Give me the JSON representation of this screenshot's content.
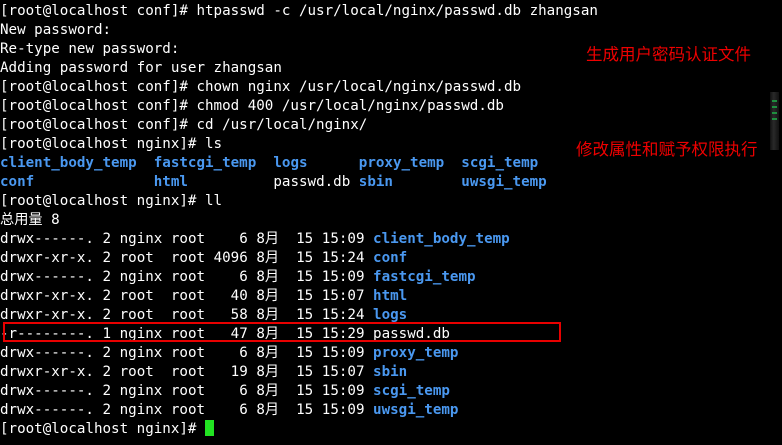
{
  "prompt_nginx_conf": "[root@localhost conf]# ",
  "prompt_nginx": "[root@localhost nginx]# ",
  "lines": {
    "l0": "htpasswd -c /usr/local/nginx/passwd.db zhangsan",
    "l1": "New password:",
    "l2": "Re-type new password:",
    "l3": "Adding password for user zhangsan",
    "l4": "chown nginx /usr/local/nginx/passwd.db",
    "l5": "chmod 400 /usr/local/nginx/passwd.db",
    "l6": "cd /usr/local/nginx/",
    "l7": "ls",
    "l10": "ll",
    "l11": "总用量 8"
  },
  "ls_output": {
    "row1": [
      "client_body_temp",
      "fastcgi_temp",
      "logs",
      "proxy_temp",
      "scgi_temp"
    ],
    "row2": [
      "conf",
      "html",
      "passwd.db",
      "sbin",
      "uwsgi_temp"
    ]
  },
  "ll_output": [
    {
      "perm": "drwx------.",
      "links": "2",
      "owner": "nginx",
      "group": "root",
      "size": "6",
      "month": "8月",
      "day": "15",
      "time": "15:09",
      "name": "client_body_temp",
      "is_dir": true
    },
    {
      "perm": "drwxr-xr-x.",
      "links": "2",
      "owner": "root",
      "group": "root",
      "size": "4096",
      "month": "8月",
      "day": "15",
      "time": "15:24",
      "name": "conf",
      "is_dir": true
    },
    {
      "perm": "drwx------.",
      "links": "2",
      "owner": "nginx",
      "group": "root",
      "size": "6",
      "month": "8月",
      "day": "15",
      "time": "15:09",
      "name": "fastcgi_temp",
      "is_dir": true
    },
    {
      "perm": "drwxr-xr-x.",
      "links": "2",
      "owner": "root",
      "group": "root",
      "size": "40",
      "month": "8月",
      "day": "15",
      "time": "15:07",
      "name": "html",
      "is_dir": true
    },
    {
      "perm": "drwxr-xr-x.",
      "links": "2",
      "owner": "root",
      "group": "root",
      "size": "58",
      "month": "8月",
      "day": "15",
      "time": "15:24",
      "name": "logs",
      "is_dir": true
    },
    {
      "perm": "-r--------.",
      "links": "1",
      "owner": "nginx",
      "group": "root",
      "size": "47",
      "month": "8月",
      "day": "15",
      "time": "15:29",
      "name": "passwd.db",
      "is_dir": false
    },
    {
      "perm": "drwx------.",
      "links": "2",
      "owner": "nginx",
      "group": "root",
      "size": "6",
      "month": "8月",
      "day": "15",
      "time": "15:09",
      "name": "proxy_temp",
      "is_dir": true
    },
    {
      "perm": "drwxr-xr-x.",
      "links": "2",
      "owner": "root",
      "group": "root",
      "size": "19",
      "month": "8月",
      "day": "15",
      "time": "15:07",
      "name": "sbin",
      "is_dir": true
    },
    {
      "perm": "drwx------.",
      "links": "2",
      "owner": "nginx",
      "group": "root",
      "size": "6",
      "month": "8月",
      "day": "15",
      "time": "15:09",
      "name": "scgi_temp",
      "is_dir": true
    },
    {
      "perm": "drwx------.",
      "links": "2",
      "owner": "nginx",
      "group": "root",
      "size": "6",
      "month": "8月",
      "day": "15",
      "time": "15:09",
      "name": "uwsgi_temp",
      "is_dir": true
    }
  ],
  "annotations": {
    "a1": "生成用户密码认证文件",
    "a2": "修改属性和赋予权限执行"
  },
  "colors": {
    "background": "#000000",
    "text": "#ffffff",
    "directory": "#4a98f0",
    "annotation": "#ee0000",
    "cursor": "#22e322"
  }
}
